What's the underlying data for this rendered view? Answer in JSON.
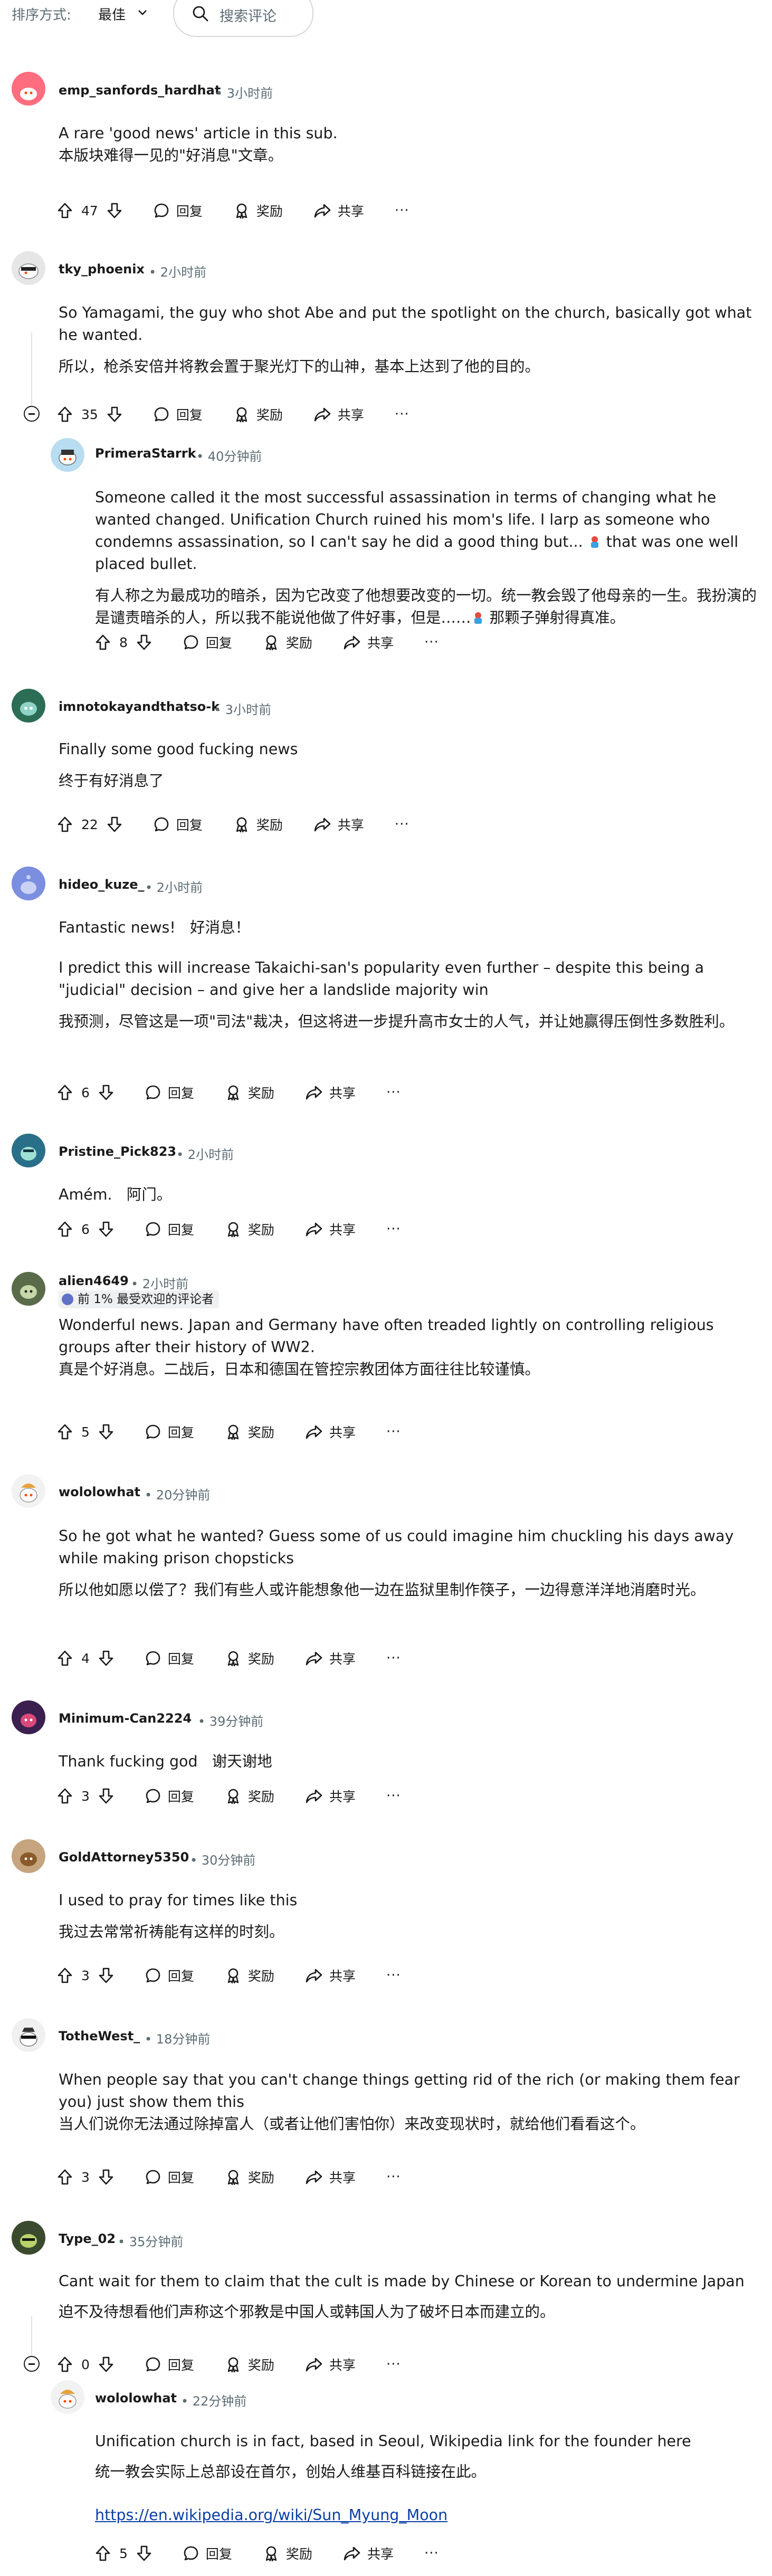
{
  "toolbar": {
    "sort_label": "排序方式:",
    "sort_value": "最佳",
    "search_placeholder": "搜索评论"
  },
  "actions": {
    "reply": "回复",
    "award": "奖励",
    "share": "共享",
    "more": "···"
  },
  "comments": [
    {
      "author": "emp_sanfords_hardhat",
      "time": "3小时前",
      "votes": "47",
      "text": "A rare 'good news' article in this sub.",
      "translation": "本版块难得一见的\"好消息\"文章。"
    },
    {
      "author": "tky_phoenix",
      "time": "2小时前",
      "votes": "35",
      "text": "So Yamagami, the guy who shot Abe and put the spotlight on the church, basically got what he wanted.",
      "translation": "所以，枪杀安倍并将教会置于聚光灯下的山神，基本上达到了他的目的。"
    },
    {
      "author": "PrimeraStarrk",
      "time": "40分钟前",
      "votes": "8",
      "text_a": "Someone called it the most successful assassination in terms of changing what he wanted changed. Unification Church ruined his mom's life. I larp as someone who condemns assassination, so I can't say he did a good thing but...",
      "text_b": "that was one well placed bullet.",
      "translation_a": "有人称之为最成功的暗杀，因为它改变了他想要改变的一切。统一教会毁了他母亲的一生。我扮演的是谴责暗杀的人，所以我不能说他做了件好事，但是……",
      "translation_b": "那颗子弹射得真准。"
    },
    {
      "author": "imnotokayandthatso-k",
      "time": "3小时前",
      "votes": "22",
      "text": "Finally some good fucking news",
      "translation": "终于有好消息了"
    },
    {
      "author": "hideo_kuze_",
      "time": "2小时前",
      "votes": "6",
      "text_1": "Fantastic news!",
      "text_1_tr": "好消息！",
      "text": "I predict this will increase Takaichi-san's popularity even further – despite this being a \"judicial\" decision – and give her a landslide majority win",
      "translation": "我预测，尽管这是一项\"司法\"裁决，但这将进一步提升高市女士的人气，并让她赢得压倒性多数胜利。"
    },
    {
      "author": "Pristine_Pick823",
      "time": "2小时前",
      "votes": "6",
      "text": "Amém.",
      "translation": "阿门。"
    },
    {
      "author": "alien4649",
      "time": "2小时前",
      "flair": "前 1% 最受欢迎的评论者",
      "votes": "5",
      "text": "Wonderful news. Japan and Germany have often treaded lightly on controlling religious groups after their history of WW2.",
      "translation": "真是个好消息。二战后，日本和德国在管控宗教团体方面往往比较谨慎。"
    },
    {
      "author": "wololowhat",
      "time": "20分钟前",
      "votes": "4",
      "text": "So he got what he wanted? Guess some of us could imagine him chuckling his days away while making prison chopsticks",
      "translation": "所以他如愿以偿了？我们有些人或许能想象他一边在监狱里制作筷子，一边得意洋洋地消磨时光。"
    },
    {
      "author": "Minimum-Can2224",
      "time": "39分钟前",
      "votes": "3",
      "text": "Thank fucking god",
      "translation": "谢天谢地"
    },
    {
      "author": "GoldAttorney5350",
      "time": "30分钟前",
      "votes": "3",
      "text": "I used to pray for times like this",
      "translation": "我过去常常祈祷能有这样的时刻。"
    },
    {
      "author": "TotheWest_",
      "time": "18分钟前",
      "votes": "3",
      "text": "When people say that you can't change things getting rid of the rich (or making them fear you) just show them this",
      "translation": "当人们说你无法通过除掉富人（或者让他们害怕你）来改变现状时，就给他们看看这个。"
    },
    {
      "author": "Type_02",
      "time": "35分钟前",
      "votes": "0",
      "text": "Cant wait for them to claim that the cult is made by Chinese or Korean to undermine Japan",
      "translation": "迫不及待想看他们声称这个邪教是中国人或韩国人为了破坏日本而建立的。"
    },
    {
      "author": "wololowhat",
      "time": "22分钟前",
      "votes": "5",
      "text": "Unification church is in fact, based in Seoul, Wikipedia link for the founder here",
      "translation": "统一教会实际上总部设在首尔，创始人维基百科链接在此。",
      "link": "https://en.wikipedia.org/wiki/Sun_Myung_Moon"
    }
  ]
}
